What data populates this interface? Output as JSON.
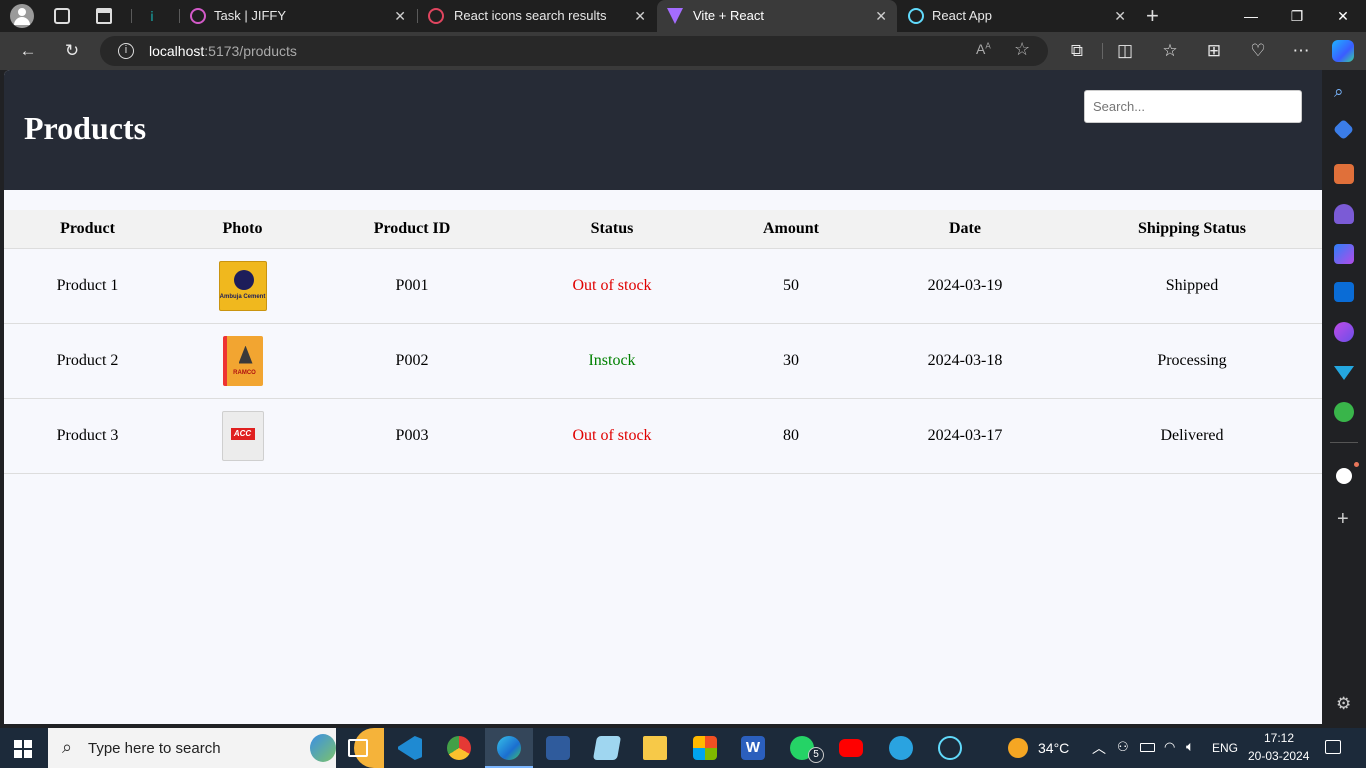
{
  "browser": {
    "tabs": [
      {
        "label": ""
      },
      {
        "label": "Task | JIFFY"
      },
      {
        "label": "React icons search results"
      },
      {
        "label": "Vite + React"
      },
      {
        "label": "React App"
      }
    ],
    "url_host": "localhost",
    "url_path": ":5173/products"
  },
  "page": {
    "title": "Products",
    "search_placeholder": "Search..."
  },
  "table": {
    "headers": [
      "Product",
      "Photo",
      "Product ID",
      "Status",
      "Amount",
      "Date",
      "Shipping Status"
    ],
    "rows": [
      {
        "product": "Product 1",
        "photo": "Ambuja Cement",
        "id": "P001",
        "status": "Out of stock",
        "amount": "50",
        "date": "2024-03-19",
        "shipping": "Shipped"
      },
      {
        "product": "Product 2",
        "photo": "RAMCO",
        "id": "P002",
        "status": "Instock",
        "amount": "30",
        "date": "2024-03-18",
        "shipping": "Processing"
      },
      {
        "product": "Product 3",
        "photo": "ACC",
        "id": "P003",
        "status": "Out of stock",
        "amount": "80",
        "date": "2024-03-17",
        "shipping": "Delivered"
      }
    ],
    "colors": {
      "out_of_stock": "#e00000",
      "instock": "#008000"
    }
  },
  "taskbar": {
    "search_placeholder": "Type here to search",
    "whatsapp_badge": "5",
    "weather": "34°C",
    "language": "ENG",
    "time": "17:12",
    "date": "20-03-2024"
  },
  "icons": [
    "profile-icon",
    "workspaces-icon",
    "tab-actions-icon",
    "back-icon",
    "refresh-icon",
    "info-icon",
    "read-aloud-icon",
    "favorite-star-icon",
    "extensions-icon",
    "split-screen-icon",
    "favorites-icon",
    "collections-icon",
    "performance-icon",
    "more-icon",
    "copilot-icon"
  ]
}
